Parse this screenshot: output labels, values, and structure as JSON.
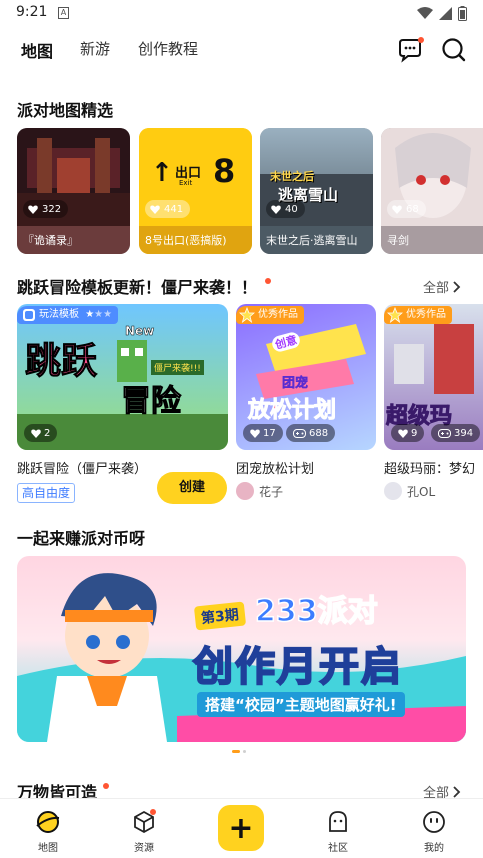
{
  "status": {
    "time": "9:21",
    "notif_letter": "A"
  },
  "topnav": {
    "tabs": [
      {
        "label": "地图"
      },
      {
        "label": "新游"
      },
      {
        "label": "创作教程"
      }
    ]
  },
  "section_party": {
    "title": "派对地图精选"
  },
  "party_maps": [
    {
      "title": "『诡谲录』",
      "likes": "322"
    },
    {
      "title": "8号出口(恶搞版)",
      "likes": "441",
      "thumb_big_number": "8",
      "thumb_label": "出口",
      "thumb_sub": "Exit"
    },
    {
      "title": "末世之后·逃离雪山",
      "likes": "40",
      "thumb_text_top": "末世之后",
      "thumb_text_bottom": "逃离雪山"
    },
    {
      "title": "寻剑",
      "likes": "68"
    }
  ],
  "section_template": {
    "title": "跳跃冒险模板更新！僵尸来袭！！",
    "more": "全部"
  },
  "templates": [
    {
      "badge": "玩法模板",
      "likes": "2",
      "title": "跳跃冒险（僵尸来袭）",
      "tag": "高自由度",
      "create_button": "创建",
      "art_big_1": "跳跃",
      "art_big_2": "冒险",
      "art_new": "New",
      "art_banner": "僵尸来袭!!!"
    },
    {
      "badge": "优秀作品",
      "likes": "17",
      "plays": "688",
      "title": "团宠放松计划",
      "author": "花子",
      "art_small": "创意",
      "art_mid": "团宠",
      "art_big": "放松计划"
    },
    {
      "badge": "优秀作品",
      "likes": "9",
      "plays": "394",
      "title": "超级玛丽：梦幻",
      "author": "孔OL",
      "art_big": "超级玛"
    }
  ],
  "section_earn": {
    "title": "一起来赚派对币呀"
  },
  "banner": {
    "issue_prefix": "第",
    "issue_num": "3",
    "issue_suffix": "期",
    "headline_top": "233派对",
    "headline_main": "创作月开启",
    "subline": "搭建“校园”主题地图赢好礼!"
  },
  "section_all": {
    "title": "万物皆可造",
    "more": "全部"
  },
  "bottom_nav": {
    "items": [
      {
        "label": "地图"
      },
      {
        "label": "资源"
      },
      {
        "label": "社区"
      },
      {
        "label": "我的"
      }
    ],
    "plus": "+"
  },
  "colors": {
    "accent": "#ffd21f",
    "red_dot": "#ff5533",
    "cta_yellow": "#ffd21f"
  }
}
